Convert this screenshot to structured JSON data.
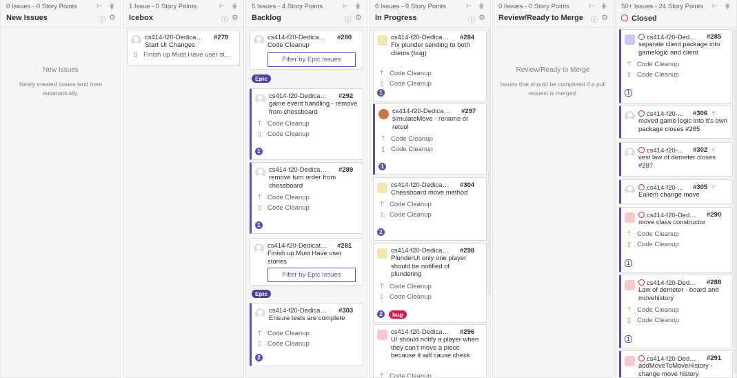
{
  "pipelines": [
    {
      "meta": "0 Issues - 0 Story Points",
      "title": "New Issues",
      "empty_title": "New Issues",
      "empty_desc": "Newly created Issues land here automatically."
    },
    {
      "meta": "1 Issue - 0 Story Points",
      "title": "Icebox"
    },
    {
      "meta": "5 Issues - 4 Story Points",
      "title": "Backlog"
    },
    {
      "meta": "6 Issues - 9 Story Points",
      "title": "In Progress"
    },
    {
      "meta": "0 Issues - 0 Story Points",
      "title": "Review/Ready to Merge",
      "empty_title": "Review/Ready to Merge",
      "empty_desc": "Issues that should be completed if a pull request is merged."
    },
    {
      "meta": "50+ Issues - 24 Story Points",
      "title": "Closed"
    }
  ],
  "epic_label": "Code Cleanup",
  "icebox": [
    {
      "repo": "cs414-f20-Dedica…",
      "num": "#279",
      "title": "Start UI Changes",
      "sub": "Finish up Must Have user st…"
    }
  ],
  "backlog": [
    {
      "repo": "cs414-f20-Dedica…",
      "num": "#280",
      "title": "Code Cleanup",
      "button": "Filter by Epic Issues",
      "label": "Epic"
    },
    {
      "repo": "cs414-f20-Dedica…",
      "num": "#292",
      "title": "game event handling - remove from chessboard",
      "pipe": "Code Cleanup",
      "epic": "Code Cleanup",
      "points": "1"
    },
    {
      "repo": "cs414-f20-Dedica…",
      "num": "#289",
      "title": "remove turn order from chessboard",
      "pipe": "Code Cleanup",
      "epic": "Code Cleanup",
      "points": "1"
    },
    {
      "repo": "cs414-f20-Dedicat…",
      "num": "#281",
      "title": "Finish up Must Have user stories",
      "button": "Filter by Epic Issues",
      "label": "Epic"
    },
    {
      "repo": "cs414-f20-Dedica…",
      "num": "#303",
      "title": "Ensure tests are complete",
      "pipe": "Code Cleanup",
      "epic": "Code Cleanup",
      "points": "2"
    }
  ],
  "inprogress": [
    {
      "repo": "cs414-f20-Dedica…",
      "num": "#284",
      "title": "Fix plunder sending to both clients (bug)",
      "pipe": "Code Cleanup",
      "epic": "Code Cleanup",
      "points": "1"
    },
    {
      "repo": "cs414-f20-Dedica…",
      "num": "#297",
      "title": "simulateMove - rename or retool",
      "pipe": "Code Cleanup",
      "epic": "Code Cleanup",
      "points": "1"
    },
    {
      "repo": "cs414-f20-Dedica…",
      "num": "#304",
      "title": "Chessboard move method",
      "pipe": "Code Cleanup",
      "epic": "Code Cleanup",
      "points": "2"
    },
    {
      "repo": "cs414-f20-Dedica…",
      "num": "#298",
      "title": "PlunderUI only one player should be notified of plundering",
      "pipe": "Code Cleanup",
      "epic": "Code Cleanup",
      "points": "2",
      "label": "bug"
    },
    {
      "repo": "cs414-f20-Dedica…",
      "num": "#296",
      "title": "UI should notify a player when they can't move a piece because it will cause check",
      "pipe": "Code Cleanup"
    }
  ],
  "closed": [
    {
      "repo": "cs414-f20-Ded…",
      "num": "#285",
      "title": "separate client package into gamelogic and client",
      "pipe": "Code Cleanup",
      "epic": "Code Cleanup",
      "points": "1"
    },
    {
      "repo": "cs414-f20-…",
      "num": "#306",
      "title": "moved game logic into it's own package closes #285"
    },
    {
      "repo": "cs414-f20-…",
      "num": "#302",
      "title": "vest law of demeter closes #287"
    },
    {
      "repo": "cs414-f20-…",
      "num": "#305",
      "title": "Ealiem change move"
    },
    {
      "repo": "cs414-f20-Ded…",
      "num": "#290",
      "title": "move class constructor",
      "pipe": "Code Cleanup",
      "epic": "Code Cleanup",
      "points": "1"
    },
    {
      "repo": "cs414-f20-Ded…",
      "num": "#288",
      "title": "Law of demeter - board and movehistory",
      "pipe": "Code Cleanup",
      "epic": "Code Cleanup",
      "points": "1"
    },
    {
      "repo": "cs414-f20-Ded…",
      "num": "#291",
      "title": "addMoveToMoveHistory - change move history"
    }
  ]
}
